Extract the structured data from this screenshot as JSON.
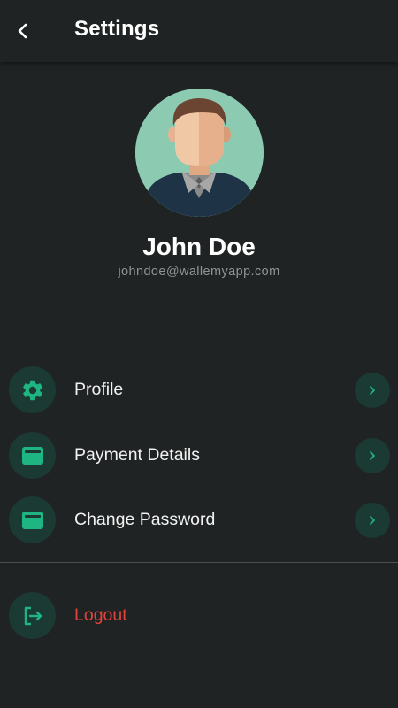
{
  "header": {
    "title": "Settings",
    "back_icon": "chevron-left-icon"
  },
  "user": {
    "name": "John Doe",
    "email": "johndoe@wallemyapp.com",
    "avatar_icon": "user-avatar-illustration"
  },
  "menu": {
    "items": [
      {
        "label": "Profile",
        "icon": "gear-icon"
      },
      {
        "label": "Payment Details",
        "icon": "wallet-icon"
      },
      {
        "label": "Change Password",
        "icon": "wallet-icon"
      }
    ],
    "chevron_icon": "chevron-right-icon"
  },
  "logout": {
    "label": "Logout",
    "icon": "logout-icon"
  },
  "colors": {
    "background": "#202323",
    "accent": "#1fb583",
    "icon_circle": "#1a3a33",
    "danger": "#e0443a",
    "secondary_text": "#8e9494"
  }
}
